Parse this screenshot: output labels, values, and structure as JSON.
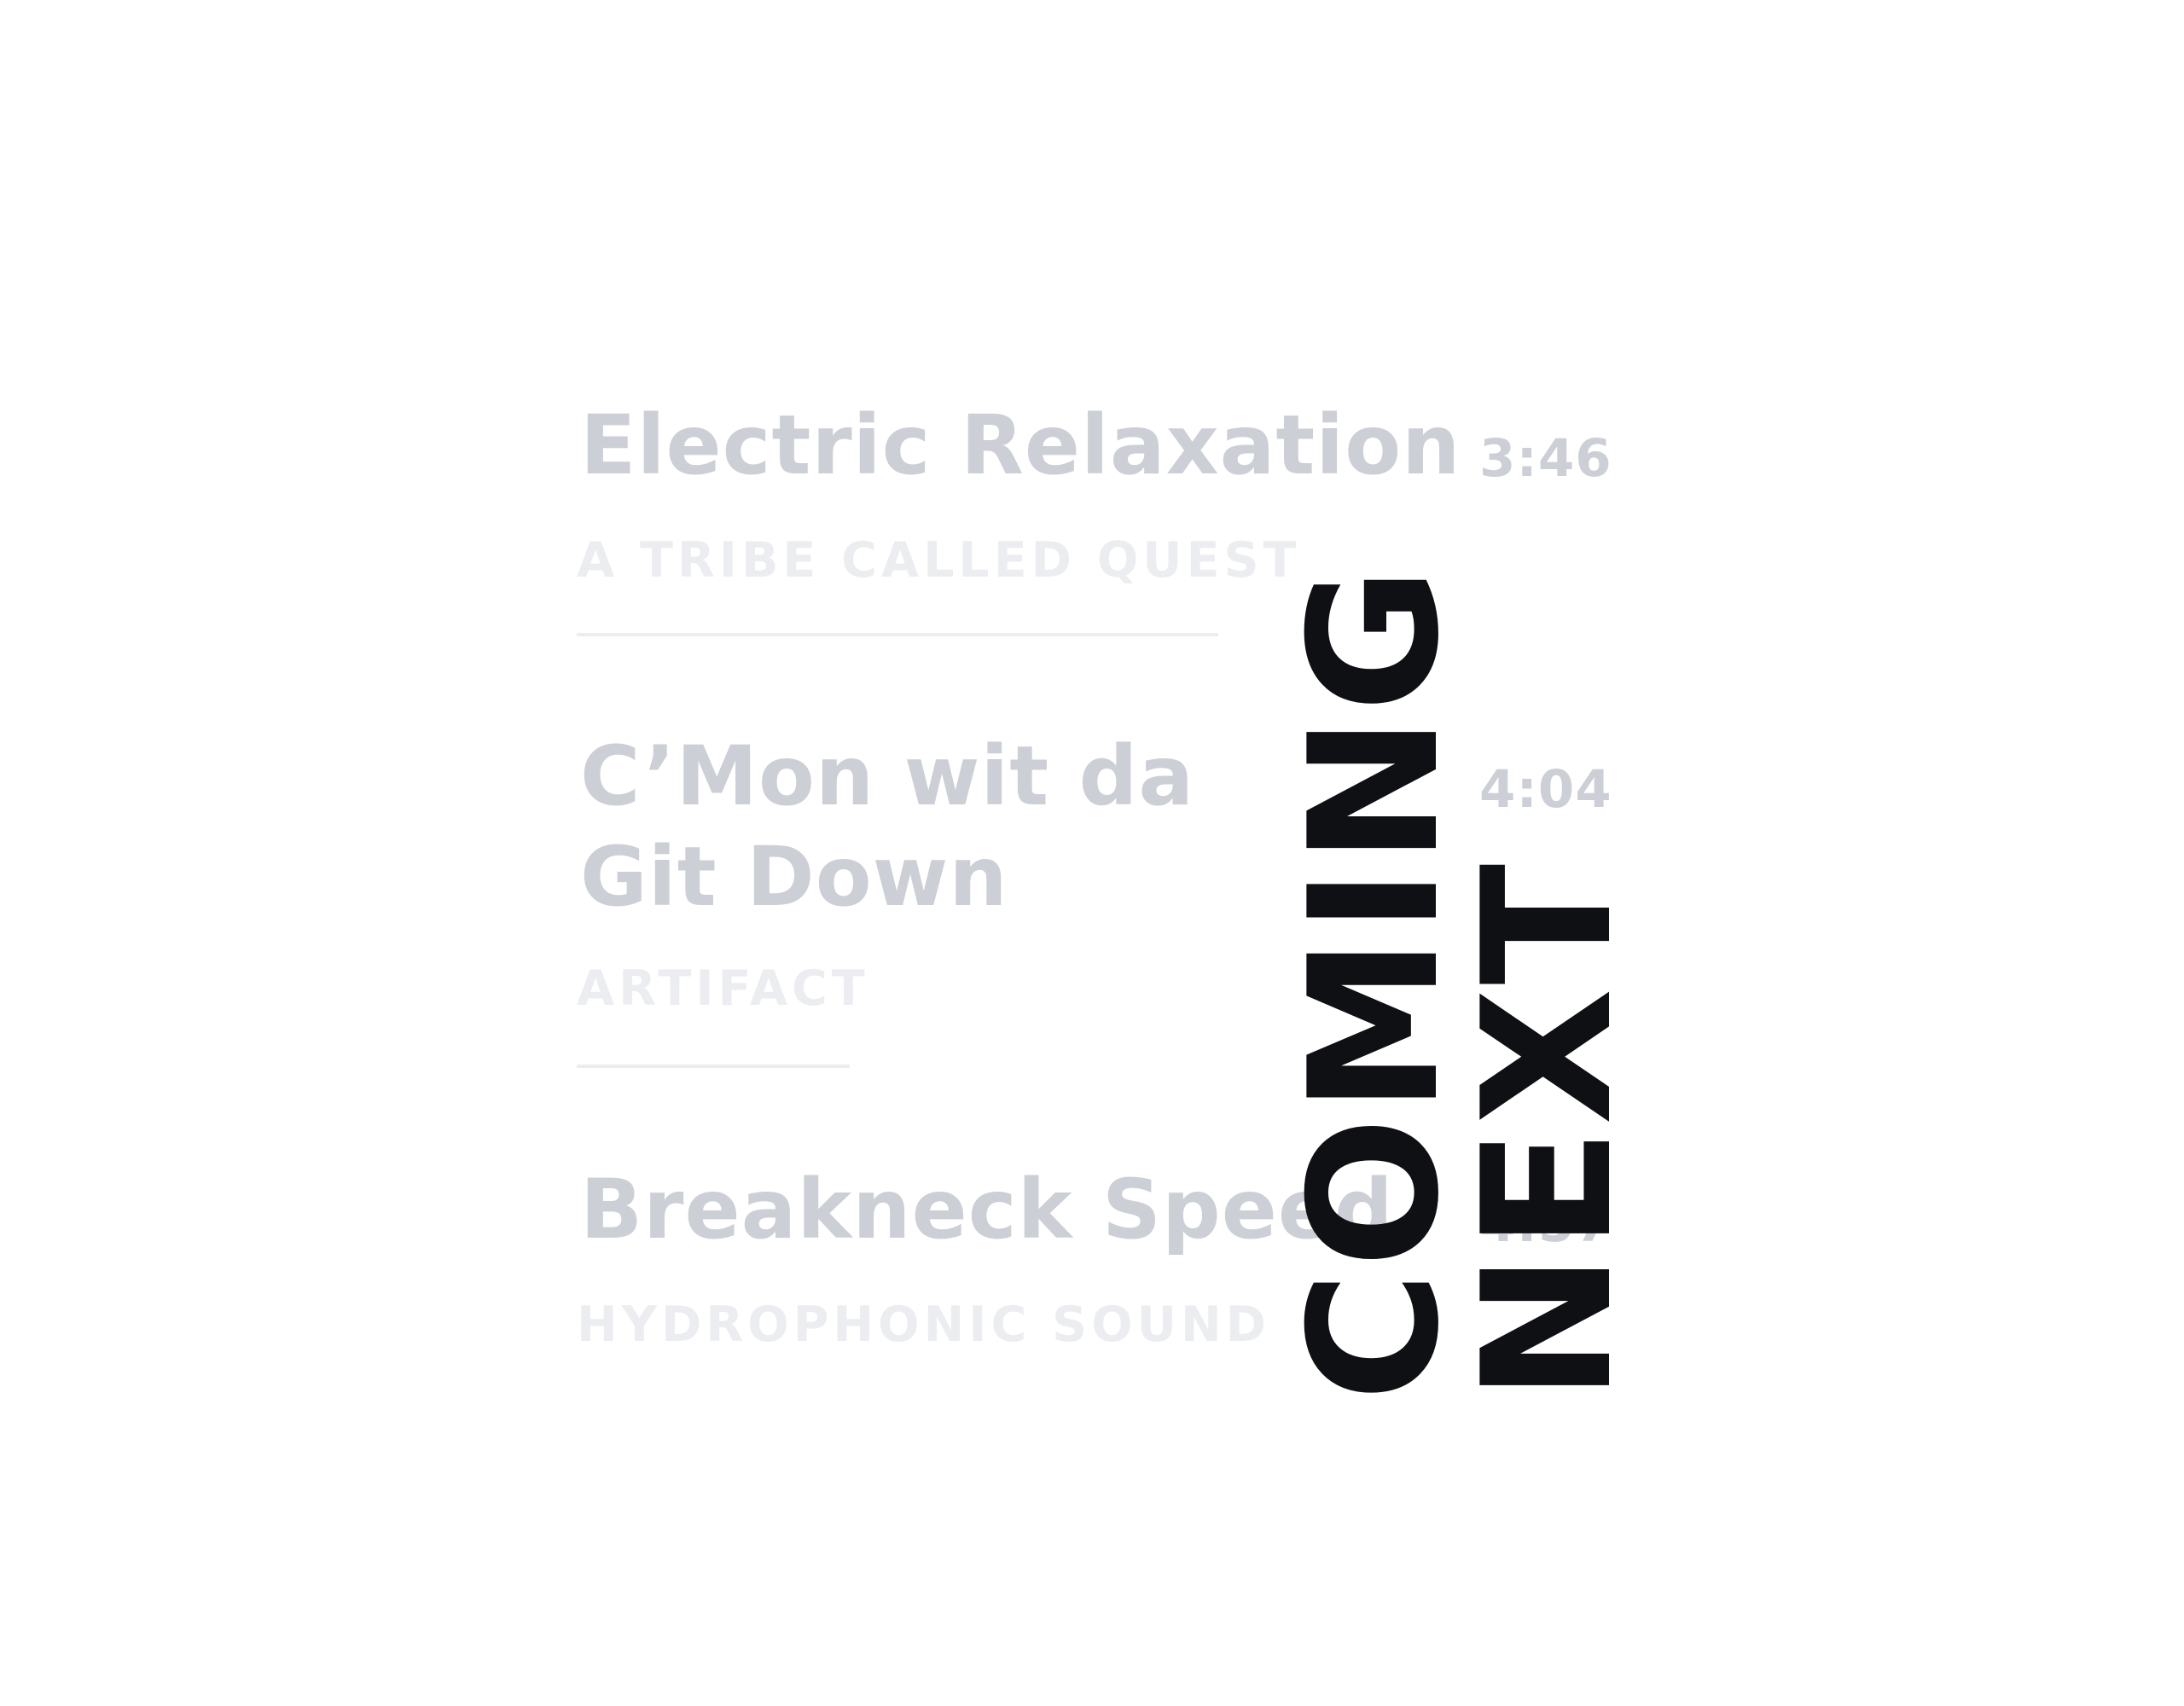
{
  "heading": {
    "line_1": "COMING",
    "line_2": "NEXT"
  },
  "tracks": [
    {
      "title_lines": [
        "Electric Relaxation"
      ],
      "artist": "A TRIBE CALLED QUEST",
      "duration": "3:46"
    },
    {
      "title_lines": [
        "C’Mon wit da",
        "Git Down"
      ],
      "artist": "ARTIFACT",
      "duration": "4:04"
    },
    {
      "title_lines": [
        "Breakneck Speed"
      ],
      "artist": "HYDROPHONIC SOUND",
      "duration": "4:57"
    }
  ],
  "colors": {
    "title": "#cdcfd6",
    "artist": "#ecedf0",
    "heading": "#0f1014",
    "background": "#ffffff"
  }
}
